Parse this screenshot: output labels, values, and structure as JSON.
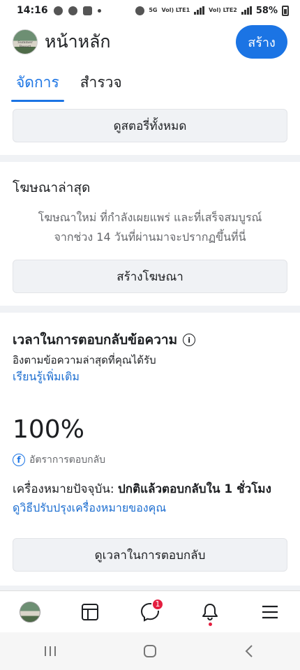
{
  "status_bar": {
    "time": "14:16",
    "network_label_1": "Vol) LTE1",
    "network_label_2": "Vol) LTE2",
    "network_5g": "5G",
    "battery_percent": "58%"
  },
  "header": {
    "title": "หน้าหลัก",
    "avatar_text": "Summer Resort",
    "create_button": "สร้าง"
  },
  "tabs": [
    {
      "label": "จัดการ",
      "active": true
    },
    {
      "label": "สำรวจ",
      "active": false
    }
  ],
  "stories": {
    "view_all_button": "ดูสตอรี่ทั้งหมด"
  },
  "ads": {
    "title": "โฆษณาล่าสุด",
    "description_line1": "โฆษณาใหม่ ที่กำลังเผยแพร่ และที่เสร็จสมบูรณ์",
    "description_line2": "จากช่วง 14 วันที่ผ่านมาจะปรากฏขึ้นที่นี่",
    "create_button": "สร้างโฆษณา"
  },
  "response": {
    "title": "เวลาในการตอบกลับข้อความ",
    "subtitle": "อิงตามข้อความล่าสุดที่คุณได้รับ",
    "learn_more": "เรียนรู้เพิ่มเติม",
    "rate_value": "100%",
    "rate_label": "อัตราการตอบกลับ",
    "badge_prefix": "เครื่องหมายปัจจุบัน: ",
    "badge_value": "ปกติแล้วตอบกลับใน 1 ชั่วโมง",
    "improve_link": "ดูวิธีปรับปรุงเครื่องหมายของคุณ",
    "view_button": "ดูเวลาในการตอบกลับ"
  },
  "bottom_nav": {
    "messages_badge": "1",
    "icons": [
      "page-avatar",
      "feed-icon",
      "messenger-icon",
      "bell-icon",
      "menu-icon"
    ]
  },
  "colors": {
    "accent": "#1b74e4",
    "badge": "#e41e3f"
  }
}
